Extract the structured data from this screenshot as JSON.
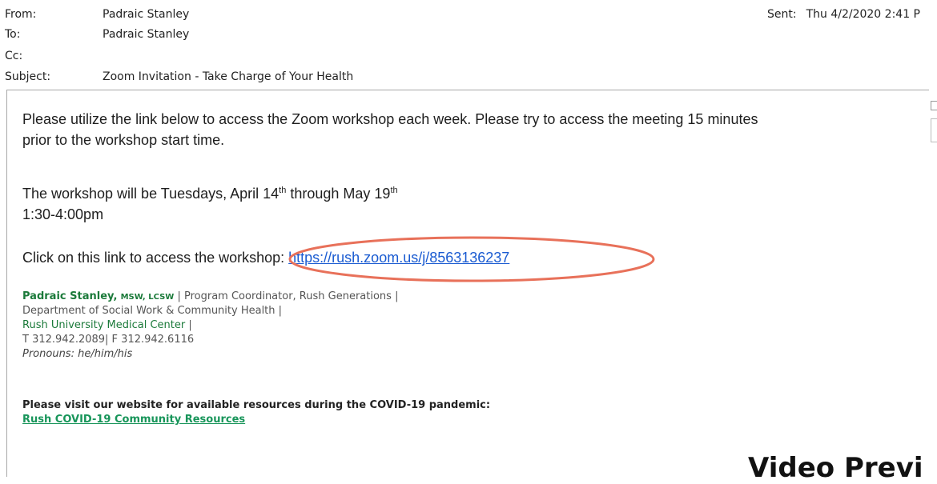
{
  "header": {
    "from_label": "From:",
    "from_value": "Padraic Stanley",
    "to_label": "To:",
    "to_value": "Padraic Stanley",
    "cc_label": "Cc:",
    "cc_value": "",
    "subject_label": "Subject:",
    "subject_value": "Zoom Invitation - Take Charge of Your Health",
    "sent_label": "Sent:",
    "sent_value": "Thu 4/2/2020 2:41 P"
  },
  "body": {
    "para1_line1": "Please utilize the link below to access the Zoom workshop each week. Please try to access the meeting 15 minutes",
    "para1_line2": "prior to the workshop start time.",
    "schedule_prefix": "The workshop will be Tuesdays, April 14",
    "schedule_sup1": "th",
    "schedule_mid": " through May 19",
    "schedule_sup2": "th",
    "time": "1:30-4:00pm",
    "link_prefix": "Click on this link to access the workshop: ",
    "link_url": "https://rush.zoom.us/j/8563136237"
  },
  "signature": {
    "name": "Padraic Stanley,",
    "credentials": "MSW, LCSW",
    "title": "| Program Coordinator, Rush Generations |",
    "department": "Department of Social Work & Community Health |",
    "org": "Rush University Medical Center",
    "org_sep": "|",
    "phones": "T 312.942.2089| F 312.942.6116",
    "pronouns": "Pronouns: he/him/his"
  },
  "covid": {
    "notice": "Please visit our website for available resources during the COVID-19 pandemic:",
    "link": "Rush COVID-19 Community Resources"
  },
  "overlay": {
    "video_preview": "Video Previ",
    "highlight_color": "#e8715a"
  }
}
